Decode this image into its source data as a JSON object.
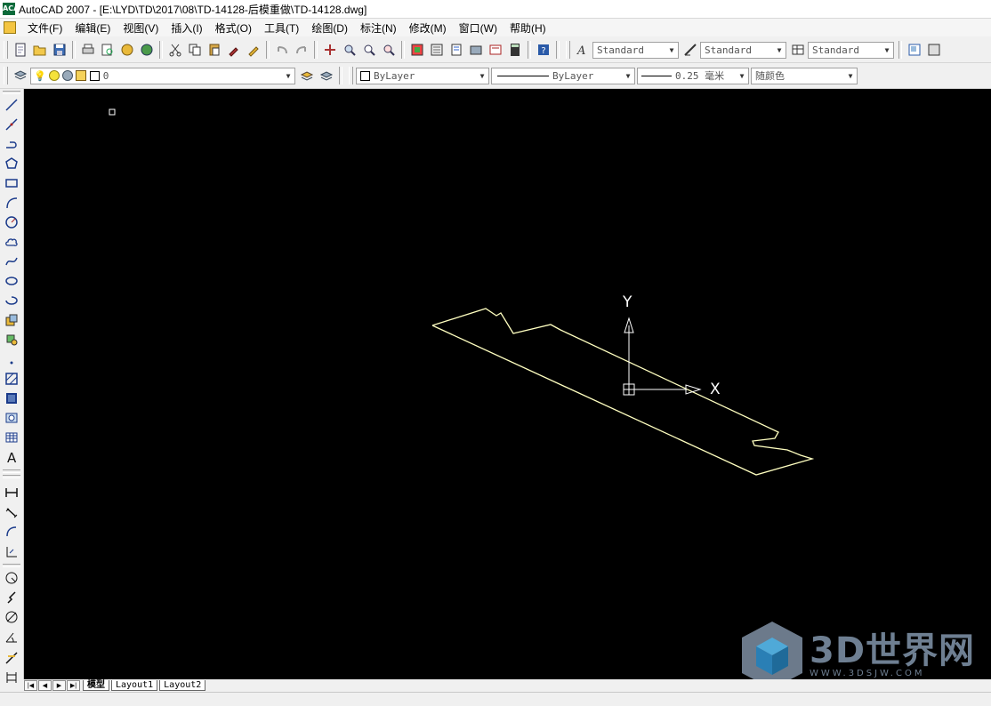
{
  "window": {
    "title": "AutoCAD 2007 - [E:\\LYD\\TD\\2017\\08\\TD-14128-后模重做\\TD-14128.dwg]",
    "app_icon_text": "ACAD"
  },
  "menu": [
    "文件(F)",
    "编辑(E)",
    "视图(V)",
    "插入(I)",
    "格式(O)",
    "工具(T)",
    "绘图(D)",
    "标注(N)",
    "修改(M)",
    "窗口(W)",
    "帮助(H)"
  ],
  "styles_toolbar": {
    "text_style": "Standard",
    "dim_style": "Standard",
    "table_style": "Standard"
  },
  "layer_toolbar": {
    "current_layer": "0"
  },
  "properties_toolbar": {
    "color": "ByLayer",
    "linetype": "ByLayer",
    "lineweight": "0.25 毫米",
    "plot_style": "随颜色"
  },
  "ucs": {
    "x_label": "X",
    "y_label": "Y"
  },
  "layout_tabs": [
    "模型",
    "Layout1",
    "Layout2"
  ],
  "active_tab": "模型",
  "watermark": {
    "main": "3D世界网",
    "sub": "WWW.3DSJW.COM"
  },
  "colors": {
    "canvas_bg": "#000000",
    "drawing_line": "#ffffc0",
    "ucs_icon": "#ffffff"
  }
}
